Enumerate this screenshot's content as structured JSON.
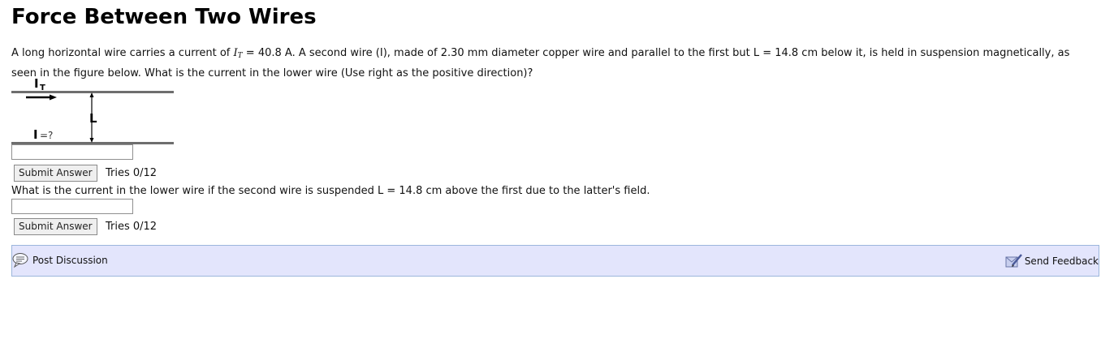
{
  "page_title": "Force Between Two Wires",
  "problem": {
    "intro": "A long horizontal wire carries a current of ",
    "var_symbol": "I",
    "var_subscript": "T",
    "after_var": " = 40.8 A. A second wire (I), made of 2.30 mm diameter copper wire and parallel to the first but L = 14.8 cm below it, is held in suspension magnetically, as seen in the figure below. What is the current in the lower wire (Use right as the positive direction)?"
  },
  "figure": {
    "top_label": "I",
    "top_label_sub": "T",
    "gap_label": "L",
    "lower_label": "I",
    "lower_label_suffix": "=?"
  },
  "questions": [
    {
      "text": "",
      "input_value": "",
      "submit_label": "Submit Answer",
      "tries": "Tries 0/12"
    },
    {
      "text": "What is the current in the lower wire if the second wire is suspended L = 14.8 cm above the first due to the latter's field.",
      "input_value": "",
      "submit_label": "Submit Answer",
      "tries": "Tries 0/12"
    }
  ],
  "footer": {
    "post_discussion": "Post Discussion",
    "send_feedback": "Send Feedback"
  },
  "colors": {
    "footer_bg": "#e3e5fc",
    "footer_border": "#9cb6dc",
    "wire": "#6e6e6e"
  }
}
